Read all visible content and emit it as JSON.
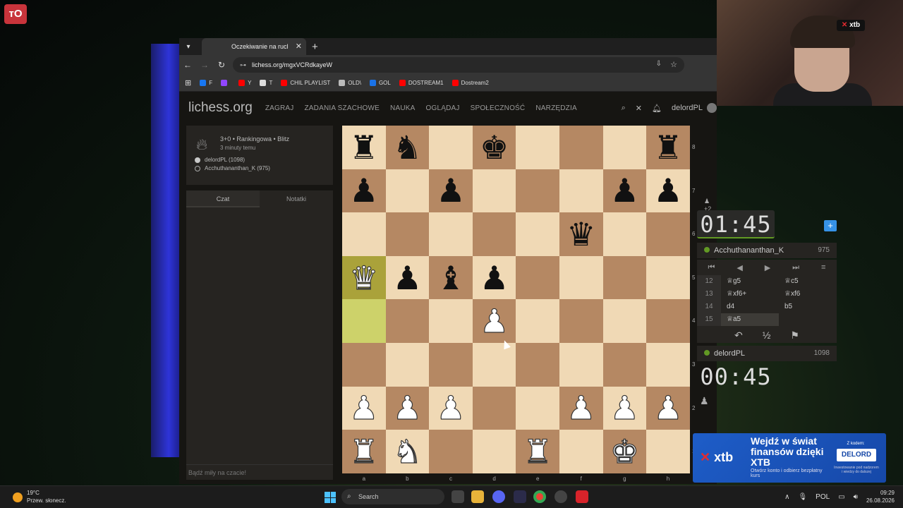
{
  "stream": {
    "logo": "ᴛO",
    "webcam_badge": "xtb"
  },
  "browser": {
    "tab_title": "Oczekiwanie na ruch przeciwnika",
    "new_tab_symbol": "+",
    "tab_close_symbol": "✕",
    "url": "lichess.org/mgxVCRdkayeW",
    "bookmarks": [
      {
        "label": "F",
        "color": "#1877f2"
      },
      {
        "label": "",
        "color": "#9146ff"
      },
      {
        "label": "Y",
        "color": "#ff0000"
      },
      {
        "label": "T",
        "color": "#dddddd"
      },
      {
        "label": "CHIL PLAYLIST",
        "color": "#ff0000"
      },
      {
        "label": "OLD\\",
        "color": "#bbbbbb"
      },
      {
        "label": "GOL",
        "color": "#1a73e8"
      },
      {
        "label": "DOSTREAM1",
        "color": "#ff0000"
      },
      {
        "label": "Dostream2",
        "color": "#ff0000"
      }
    ]
  },
  "lichess": {
    "logo": "lichess.org",
    "nav": [
      "ZAGRAJ",
      "ZADANIA SZACHOWE",
      "NAUKA",
      "OGLĄDAJ",
      "SPOŁECZNOŚĆ",
      "NARZĘDZIA"
    ],
    "username": "delordPL",
    "game": {
      "mode": "3+0 • Rankingowa • Blitz",
      "started": "3 minuty temu",
      "white_player": "delordPL (1098)",
      "black_player": "Acchuthananthan_K (975)"
    },
    "chat": {
      "tab_chat": "Czat",
      "tab_notes": "Notatki",
      "footer": "Bądź miły na czacie!"
    },
    "board": {
      "ranks": [
        "8",
        "7",
        "6",
        "5",
        "4",
        "3",
        "2",
        "1"
      ],
      "files": [
        "a",
        "b",
        "c",
        "d",
        "e",
        "f",
        "g",
        "h"
      ],
      "position": [
        [
          "r",
          "n",
          "",
          "k",
          "",
          "",
          "",
          "r"
        ],
        [
          "p",
          "",
          "p",
          "",
          "",
          "",
          "p",
          "p"
        ],
        [
          "",
          "",
          "",
          "",
          "",
          "q",
          "",
          ""
        ],
        [
          "Q",
          "p",
          "b",
          "p",
          "",
          "",
          "",
          ""
        ],
        [
          "",
          "",
          "",
          "P",
          "",
          "",
          "",
          ""
        ],
        [
          "",
          "",
          "",
          "",
          "",
          "",
          "",
          ""
        ],
        [
          "P",
          "P",
          "P",
          "",
          "",
          "P",
          "P",
          "P"
        ],
        [
          "R",
          "N",
          "",
          "",
          "R",
          "",
          "K",
          ""
        ]
      ],
      "highlight": [
        [
          3,
          0
        ],
        [
          4,
          0
        ]
      ]
    },
    "opponent": {
      "clock": "01:45",
      "name": "Acchuthananthan_K",
      "rating": "975",
      "pocket": "♟ +2"
    },
    "player": {
      "clock": "00:45",
      "name": "delordPL",
      "rating": "1098"
    },
    "moves": [
      {
        "n": "12",
        "w": "♕g5",
        "b": "♕c5"
      },
      {
        "n": "13",
        "w": "♕xf6+",
        "b": "♕xf6"
      },
      {
        "n": "14",
        "w": "d4",
        "b": "b5"
      },
      {
        "n": "15",
        "w": "♕a5",
        "b": ""
      }
    ],
    "controls": [
      "⏮",
      "◀",
      "▶",
      "⏭",
      "≡"
    ],
    "actions": [
      "↶",
      "½",
      "⚑"
    ]
  },
  "ad": {
    "logo": "xtb",
    "headline": "Wejdź w świat finansów dzięki XTB",
    "sub": "Otwórz konto i odbierz bezpłatny kurs",
    "code_label": "Z kodem:",
    "code": "DELORD",
    "small": "Inwestowanie pod nadzorem i wiedzy do dalszej"
  },
  "taskbar": {
    "temp": "19°C",
    "weather": "Przew. słonecz.",
    "search": "Search",
    "lang": "POL",
    "time": "09:29",
    "date": "26.08.2026"
  }
}
